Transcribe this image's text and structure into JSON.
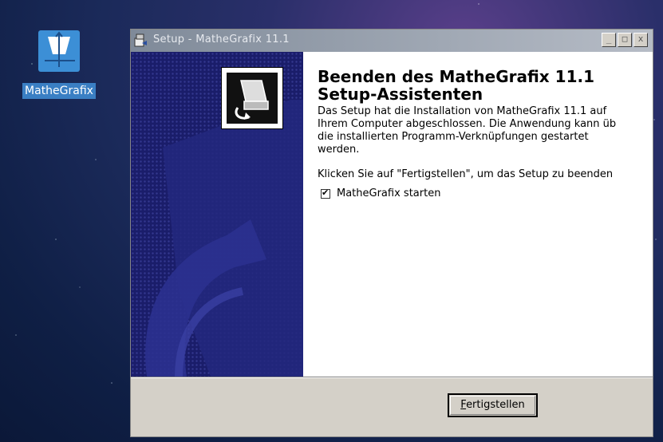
{
  "desktop": {
    "icon_label": "MatheGrafix"
  },
  "window": {
    "title": "Setup - MatheGrafix 11.1",
    "controls": {
      "minimize": "_",
      "maximize": "□",
      "close": "x"
    }
  },
  "page": {
    "heading": "Beenden des MatheGrafix 11.1 Setup-Assistenten",
    "paragraph": "Das Setup hat die Installation von MatheGrafix 11.1 auf\nIhrem Computer abgeschlossen. Die Anwendung kann üb\ndie installierten Programm-Verknüpfungen gestartet\nwerden.",
    "click_instruction": "Klicken Sie auf \"Fertigstellen\", um das Setup zu beenden",
    "checkbox": {
      "label": "MatheGrafix starten",
      "checked": true
    }
  },
  "buttons": {
    "finish_accel": "F",
    "finish_rest": "ertigstellen"
  }
}
